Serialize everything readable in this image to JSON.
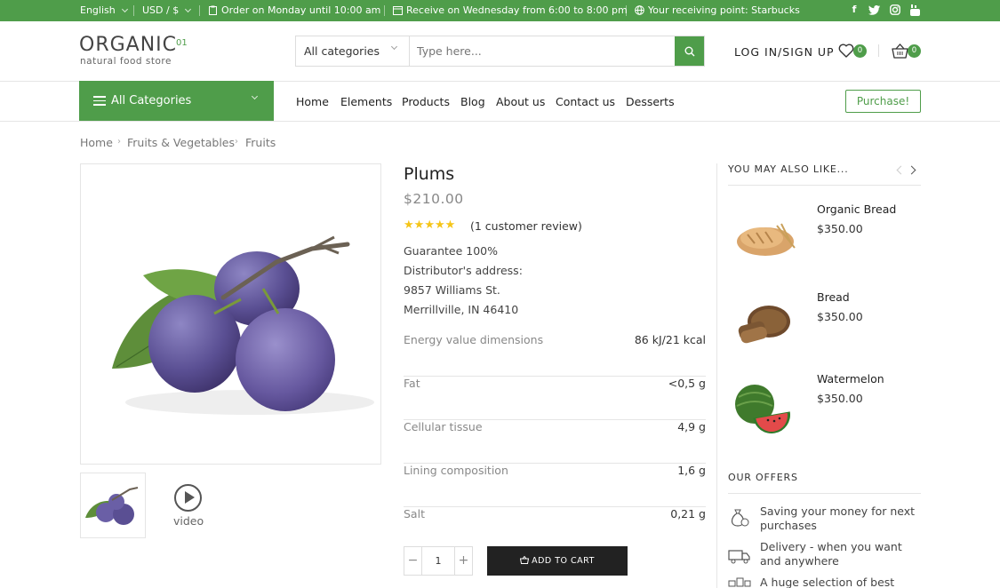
{
  "topbar": {
    "language": "English",
    "currency": "USD / $",
    "order_note": "Order on Monday until 10:00 am",
    "receive_note": "Receive on Wednesday from 6:00 to 8:00 pm",
    "pickup_point": "Your receiving point: Starbucks",
    "social": [
      "f",
      "t",
      "ig",
      "yt"
    ]
  },
  "header": {
    "logo": "ORGANIC",
    "logo_sup": "01",
    "tagline": "natural food store",
    "category_select": "All categories",
    "search_placeholder": "Type here...",
    "login": "LOG IN/SIGN UP",
    "wishlist_count": "0",
    "cart_count": "0"
  },
  "nav": {
    "all_categories": "All Categories",
    "links": [
      "Home",
      "Elements",
      "Products",
      "Blog",
      "About us",
      "Contact us",
      "Desserts"
    ],
    "purchase": "Purchase!"
  },
  "breadcrumb": [
    "Home",
    "Fruits & Vegetables",
    "Fruits"
  ],
  "product": {
    "title": "Plums",
    "price": "$210.00",
    "rating": 5,
    "review_text": "(1 customer review)",
    "details": [
      "Guarantee 100%",
      "Distributor's address:",
      "9857 Williams St.",
      "Merrillville, IN 46410"
    ],
    "specs": [
      {
        "name": "Energy value dimensions",
        "value": "86 kJ/21 kcal"
      },
      {
        "name": "Fat",
        "value": "<0,5 g"
      },
      {
        "name": "Cellular tissue",
        "value": "4,9 g"
      },
      {
        "name": "Lining composition",
        "value": "1,6 g"
      },
      {
        "name": "Salt",
        "value": "0,21 g"
      }
    ],
    "video_label": "video",
    "quantity": "1",
    "add_to_cart": "ADD TO CART"
  },
  "sidebar": {
    "related_title": "YOU MAY ALSO LIKE...",
    "related": [
      {
        "name": "Organic Bread",
        "price": "$350.00"
      },
      {
        "name": "Bread",
        "price": "$350.00"
      },
      {
        "name": "Watermelon",
        "price": "$350.00"
      }
    ],
    "offers_title": "OUR OFFERS",
    "offers": [
      "Saving your money for next purchases",
      "Delivery - when you want and anywhere",
      "A huge selection of best"
    ]
  },
  "colors": {
    "brand_green": "#4f9d4a",
    "dark": "#222222"
  }
}
